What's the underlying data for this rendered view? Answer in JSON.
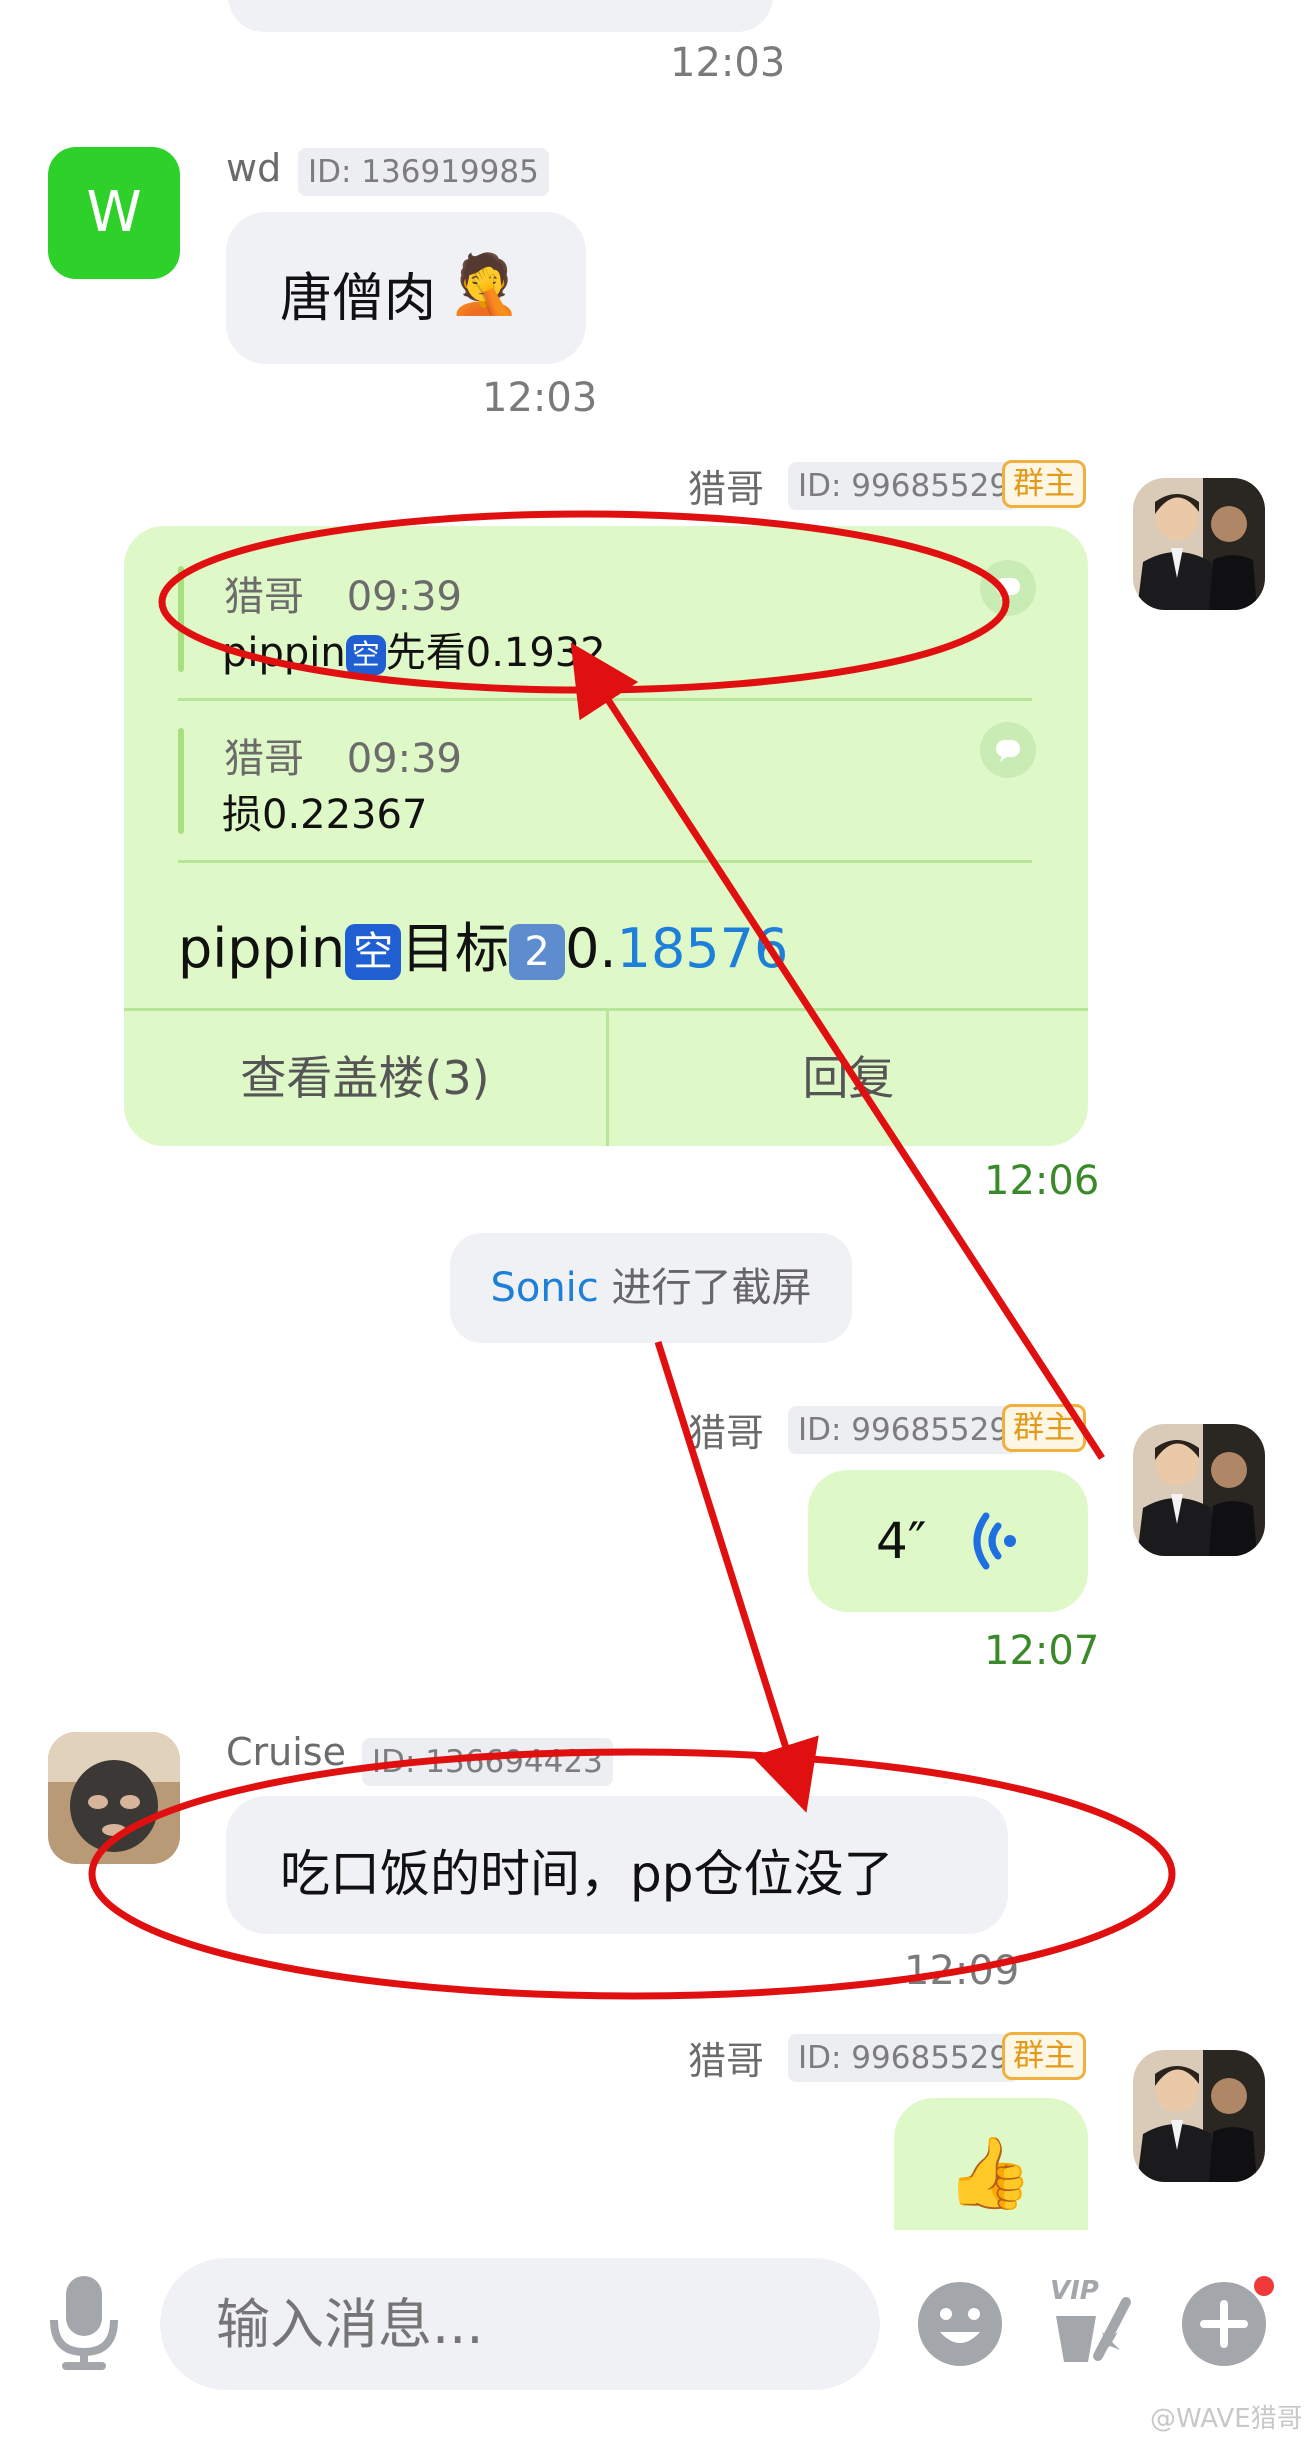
{
  "top_time": "12:03",
  "msg_wd": {
    "avatar_letter": "W",
    "name": "wd",
    "id": "ID: 136919985",
    "text": "唐僧肉",
    "emoji": "🤦",
    "time": "12:03"
  },
  "msg_liege1": {
    "name": "猎哥",
    "id": "ID: 99685529",
    "badge": "群主",
    "quote1_name": "猎哥",
    "quote1_time": "09:39",
    "quote1_text_a": "pippin",
    "quote1_chip": "空",
    "quote1_text_b": "先看0.1932",
    "quote2_name": "猎哥",
    "quote2_time": "09:39",
    "quote2_text": "损0.22367",
    "main_a": "pippin",
    "main_chip": "空",
    "main_b": "目标",
    "main_num_chip": "2",
    "main_c": "0.",
    "main_d": "18576",
    "btn_view": "查看盖楼(3)",
    "btn_reply": "回复",
    "time": "12:06"
  },
  "system_notice": {
    "actor": "Sonic",
    "text": " 进行了截屏"
  },
  "msg_liege2": {
    "name": "猎哥",
    "id": "ID: 99685529",
    "badge": "群主",
    "voice_duration": "4″",
    "time": "12:07"
  },
  "msg_cruise": {
    "name": "Cruise",
    "id": "ID: 136694423",
    "text": "吃口饭的时间，pp仓位没了",
    "time": "12:09"
  },
  "msg_liege3": {
    "name": "猎哥",
    "id": "ID: 99685529",
    "badge": "群主",
    "emoji": "👍"
  },
  "input_bar": {
    "placeholder": "输入消息...",
    "vip_label": "VIP"
  },
  "watermark": "@WAVE猎哥",
  "colors": {
    "annotation": "#e01010",
    "bubble_green": "#dff8c8",
    "bubble_gray": "#eff1f4",
    "link_blue": "#1e7fd8"
  }
}
